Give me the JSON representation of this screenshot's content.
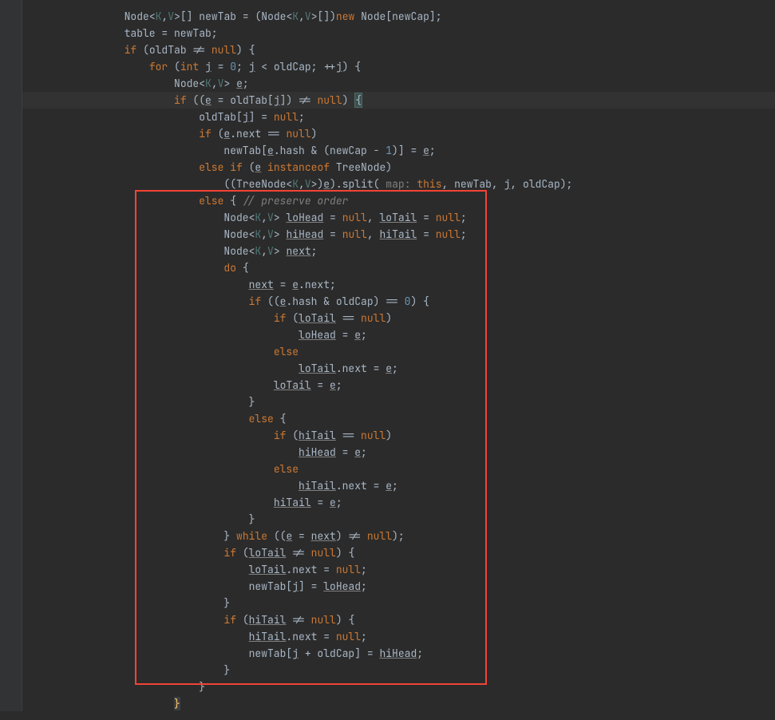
{
  "lines": [
    {
      "indent": 3,
      "tokens": [
        {
          "t": "Node",
          "c": "ty"
        },
        {
          "t": "<",
          "c": "op"
        },
        {
          "t": "K",
          "c": "gp"
        },
        {
          "t": ",",
          "c": "op"
        },
        {
          "t": "V",
          "c": "gp"
        },
        {
          "t": ">[] newTab = (Node",
          "c": "ty"
        },
        {
          "t": "<",
          "c": "op"
        },
        {
          "t": "K",
          "c": "gp"
        },
        {
          "t": ",",
          "c": "op"
        },
        {
          "t": "V",
          "c": "gp"
        },
        {
          "t": ">[])",
          "c": "ty"
        },
        {
          "t": "new ",
          "c": "kw"
        },
        {
          "t": "Node[newCap];",
          "c": "ty"
        }
      ]
    },
    {
      "indent": 3,
      "tokens": [
        {
          "t": "table = newTab;",
          "c": "ty"
        }
      ]
    },
    {
      "indent": 3,
      "tokens": [
        {
          "t": "if ",
          "c": "kw"
        },
        {
          "t": "(oldTab != ",
          "c": "ty"
        },
        {
          "t": "null",
          "c": "kw"
        },
        {
          "t": ") {",
          "c": "ty"
        }
      ]
    },
    {
      "indent": 4,
      "tokens": [
        {
          "t": "for ",
          "c": "kw"
        },
        {
          "t": "(",
          "c": "ty"
        },
        {
          "t": "int ",
          "c": "kw"
        },
        {
          "t": "j",
          "c": "ul"
        },
        {
          "t": " = ",
          "c": "ty"
        },
        {
          "t": "0",
          "c": "num"
        },
        {
          "t": "; ",
          "c": "ty"
        },
        {
          "t": "j",
          "c": "ul"
        },
        {
          "t": " < oldCap; ++",
          "c": "ty"
        },
        {
          "t": "j",
          "c": "ul"
        },
        {
          "t": ") {",
          "c": "ty"
        }
      ]
    },
    {
      "indent": 5,
      "tokens": [
        {
          "t": "Node",
          "c": "ty"
        },
        {
          "t": "<",
          "c": "op"
        },
        {
          "t": "K",
          "c": "gp"
        },
        {
          "t": ",",
          "c": "op"
        },
        {
          "t": "V",
          "c": "gp"
        },
        {
          "t": "> ",
          "c": "ty"
        },
        {
          "t": "e",
          "c": "ul"
        },
        {
          "t": ";",
          "c": "ty"
        }
      ]
    },
    {
      "indent": 5,
      "hl": true,
      "tokens": [
        {
          "t": "if ",
          "c": "kw"
        },
        {
          "t": "((",
          "c": "ty"
        },
        {
          "t": "e",
          "c": "ul"
        },
        {
          "t": " = oldTab[",
          "c": "ty"
        },
        {
          "t": "j",
          "c": "ul"
        },
        {
          "t": "]) != ",
          "c": "ty"
        },
        {
          "t": "null",
          "c": "kw"
        },
        {
          "t": ") ",
          "c": "ty"
        },
        {
          "t": "{",
          "c": "brace-match"
        }
      ]
    },
    {
      "indent": 6,
      "tokens": [
        {
          "t": "oldTab[",
          "c": "ty"
        },
        {
          "t": "j",
          "c": "ul"
        },
        {
          "t": "] = ",
          "c": "ty"
        },
        {
          "t": "null",
          "c": "kw"
        },
        {
          "t": ";",
          "c": "ty"
        }
      ]
    },
    {
      "indent": 6,
      "tokens": [
        {
          "t": "if ",
          "c": "kw"
        },
        {
          "t": "(",
          "c": "ty"
        },
        {
          "t": "e",
          "c": "ul"
        },
        {
          "t": ".next == ",
          "c": "ty"
        },
        {
          "t": "null",
          "c": "kw"
        },
        {
          "t": ")",
          "c": "ty"
        }
      ]
    },
    {
      "indent": 7,
      "tokens": [
        {
          "t": "newTab[",
          "c": "ty"
        },
        {
          "t": "e",
          "c": "ul"
        },
        {
          "t": ".hash & (newCap - ",
          "c": "ty"
        },
        {
          "t": "1",
          "c": "num"
        },
        {
          "t": ")] = ",
          "c": "ty"
        },
        {
          "t": "e",
          "c": "ul"
        },
        {
          "t": ";",
          "c": "ty"
        }
      ]
    },
    {
      "indent": 6,
      "tokens": [
        {
          "t": "else if ",
          "c": "kw"
        },
        {
          "t": "(",
          "c": "ty"
        },
        {
          "t": "e",
          "c": "ul"
        },
        {
          "t": " ",
          "c": "ty"
        },
        {
          "t": "instanceof ",
          "c": "kw"
        },
        {
          "t": "TreeNode)",
          "c": "ty"
        }
      ]
    },
    {
      "indent": 7,
      "tokens": [
        {
          "t": "((TreeNode",
          "c": "ty"
        },
        {
          "t": "<",
          "c": "op"
        },
        {
          "t": "K",
          "c": "gp"
        },
        {
          "t": ",",
          "c": "op"
        },
        {
          "t": "V",
          "c": "gp"
        },
        {
          "t": ">)",
          "c": "ty"
        },
        {
          "t": "e",
          "c": "ul"
        },
        {
          "t": ").split(",
          "c": "ty"
        },
        {
          "t": " map: ",
          "c": "lbl"
        },
        {
          "t": "this",
          "c": "kw"
        },
        {
          "t": ", newTab, ",
          "c": "ty"
        },
        {
          "t": "j",
          "c": "ul"
        },
        {
          "t": ", oldCap);",
          "c": "ty"
        }
      ]
    },
    {
      "indent": 6,
      "tokens": [
        {
          "t": "else ",
          "c": "kw"
        },
        {
          "t": "{ ",
          "c": "ty"
        },
        {
          "t": "// preserve order",
          "c": "cmt"
        }
      ]
    },
    {
      "indent": 7,
      "tokens": [
        {
          "t": "Node",
          "c": "ty"
        },
        {
          "t": "<",
          "c": "op"
        },
        {
          "t": "K",
          "c": "gp"
        },
        {
          "t": ",",
          "c": "op"
        },
        {
          "t": "V",
          "c": "gp"
        },
        {
          "t": "> ",
          "c": "ty"
        },
        {
          "t": "loHead",
          "c": "ul"
        },
        {
          "t": " = ",
          "c": "ty"
        },
        {
          "t": "null",
          "c": "kw"
        },
        {
          "t": ", ",
          "c": "ty"
        },
        {
          "t": "loTail",
          "c": "ul"
        },
        {
          "t": " = ",
          "c": "ty"
        },
        {
          "t": "null",
          "c": "kw"
        },
        {
          "t": ";",
          "c": "ty"
        }
      ]
    },
    {
      "indent": 7,
      "tokens": [
        {
          "t": "Node",
          "c": "ty"
        },
        {
          "t": "<",
          "c": "op"
        },
        {
          "t": "K",
          "c": "gp"
        },
        {
          "t": ",",
          "c": "op"
        },
        {
          "t": "V",
          "c": "gp"
        },
        {
          "t": "> ",
          "c": "ty"
        },
        {
          "t": "hiHead",
          "c": "ul"
        },
        {
          "t": " = ",
          "c": "ty"
        },
        {
          "t": "null",
          "c": "kw"
        },
        {
          "t": ", ",
          "c": "ty"
        },
        {
          "t": "hiTail",
          "c": "ul"
        },
        {
          "t": " = ",
          "c": "ty"
        },
        {
          "t": "null",
          "c": "kw"
        },
        {
          "t": ";",
          "c": "ty"
        }
      ]
    },
    {
      "indent": 7,
      "tokens": [
        {
          "t": "Node",
          "c": "ty"
        },
        {
          "t": "<",
          "c": "op"
        },
        {
          "t": "K",
          "c": "gp"
        },
        {
          "t": ",",
          "c": "op"
        },
        {
          "t": "V",
          "c": "gp"
        },
        {
          "t": "> ",
          "c": "ty"
        },
        {
          "t": "next",
          "c": "ul"
        },
        {
          "t": ";",
          "c": "ty"
        }
      ]
    },
    {
      "indent": 7,
      "tokens": [
        {
          "t": "do ",
          "c": "kw"
        },
        {
          "t": "{",
          "c": "ty"
        }
      ]
    },
    {
      "indent": 8,
      "tokens": [
        {
          "t": "next",
          "c": "ul"
        },
        {
          "t": " = ",
          "c": "ty"
        },
        {
          "t": "e",
          "c": "ul"
        },
        {
          "t": ".next;",
          "c": "ty"
        }
      ]
    },
    {
      "indent": 8,
      "tokens": [
        {
          "t": "if ",
          "c": "kw"
        },
        {
          "t": "((",
          "c": "ty"
        },
        {
          "t": "e",
          "c": "ul"
        },
        {
          "t": ".hash & oldCap) == ",
          "c": "ty"
        },
        {
          "t": "0",
          "c": "num"
        },
        {
          "t": ") {",
          "c": "ty"
        }
      ]
    },
    {
      "indent": 9,
      "tokens": [
        {
          "t": "if ",
          "c": "kw"
        },
        {
          "t": "(",
          "c": "ty"
        },
        {
          "t": "loTail",
          "c": "ul"
        },
        {
          "t": " == ",
          "c": "ty"
        },
        {
          "t": "null",
          "c": "kw"
        },
        {
          "t": ")",
          "c": "ty"
        }
      ]
    },
    {
      "indent": 10,
      "tokens": [
        {
          "t": "loHead",
          "c": "ul"
        },
        {
          "t": " = ",
          "c": "ty"
        },
        {
          "t": "e",
          "c": "ul"
        },
        {
          "t": ";",
          "c": "ty"
        }
      ]
    },
    {
      "indent": 9,
      "tokens": [
        {
          "t": "else",
          "c": "kw"
        }
      ]
    },
    {
      "indent": 10,
      "tokens": [
        {
          "t": "loTail",
          "c": "ul"
        },
        {
          "t": ".next = ",
          "c": "ty"
        },
        {
          "t": "e",
          "c": "ul"
        },
        {
          "t": ";",
          "c": "ty"
        }
      ]
    },
    {
      "indent": 9,
      "tokens": [
        {
          "t": "loTail",
          "c": "ul"
        },
        {
          "t": " = ",
          "c": "ty"
        },
        {
          "t": "e",
          "c": "ul"
        },
        {
          "t": ";",
          "c": "ty"
        }
      ]
    },
    {
      "indent": 8,
      "tokens": [
        {
          "t": "}",
          "c": "ty"
        }
      ]
    },
    {
      "indent": 8,
      "tokens": [
        {
          "t": "else ",
          "c": "kw"
        },
        {
          "t": "{",
          "c": "ty"
        }
      ]
    },
    {
      "indent": 9,
      "tokens": [
        {
          "t": "if ",
          "c": "kw"
        },
        {
          "t": "(",
          "c": "ty"
        },
        {
          "t": "hiTail",
          "c": "ul"
        },
        {
          "t": " == ",
          "c": "ty"
        },
        {
          "t": "null",
          "c": "kw"
        },
        {
          "t": ")",
          "c": "ty"
        }
      ]
    },
    {
      "indent": 10,
      "tokens": [
        {
          "t": "hiHead",
          "c": "ul"
        },
        {
          "t": " = ",
          "c": "ty"
        },
        {
          "t": "e",
          "c": "ul"
        },
        {
          "t": ";",
          "c": "ty"
        }
      ]
    },
    {
      "indent": 9,
      "tokens": [
        {
          "t": "else",
          "c": "kw"
        }
      ]
    },
    {
      "indent": 10,
      "tokens": [
        {
          "t": "hiTail",
          "c": "ul"
        },
        {
          "t": ".next = ",
          "c": "ty"
        },
        {
          "t": "e",
          "c": "ul"
        },
        {
          "t": ";",
          "c": "ty"
        }
      ]
    },
    {
      "indent": 9,
      "tokens": [
        {
          "t": "hiTail",
          "c": "ul"
        },
        {
          "t": " = ",
          "c": "ty"
        },
        {
          "t": "e",
          "c": "ul"
        },
        {
          "t": ";",
          "c": "ty"
        }
      ]
    },
    {
      "indent": 8,
      "tokens": [
        {
          "t": "}",
          "c": "ty"
        }
      ]
    },
    {
      "indent": 7,
      "tokens": [
        {
          "t": "} ",
          "c": "ty"
        },
        {
          "t": "while ",
          "c": "kw"
        },
        {
          "t": "((",
          "c": "ty"
        },
        {
          "t": "e",
          "c": "ul"
        },
        {
          "t": " = ",
          "c": "ty"
        },
        {
          "t": "next",
          "c": "ul"
        },
        {
          "t": ") != ",
          "c": "ty"
        },
        {
          "t": "null",
          "c": "kw"
        },
        {
          "t": ");",
          "c": "ty"
        }
      ]
    },
    {
      "indent": 7,
      "tokens": [
        {
          "t": "if ",
          "c": "kw"
        },
        {
          "t": "(",
          "c": "ty"
        },
        {
          "t": "loTail",
          "c": "ul"
        },
        {
          "t": " != ",
          "c": "ty"
        },
        {
          "t": "null",
          "c": "kw"
        },
        {
          "t": ") {",
          "c": "ty"
        }
      ]
    },
    {
      "indent": 8,
      "tokens": [
        {
          "t": "loTail",
          "c": "ul"
        },
        {
          "t": ".next = ",
          "c": "ty"
        },
        {
          "t": "null",
          "c": "kw"
        },
        {
          "t": ";",
          "c": "ty"
        }
      ]
    },
    {
      "indent": 8,
      "tokens": [
        {
          "t": "newTab[",
          "c": "ty"
        },
        {
          "t": "j",
          "c": "ul"
        },
        {
          "t": "] = ",
          "c": "ty"
        },
        {
          "t": "loHead",
          "c": "ul"
        },
        {
          "t": ";",
          "c": "ty"
        }
      ]
    },
    {
      "indent": 7,
      "tokens": [
        {
          "t": "}",
          "c": "ty"
        }
      ]
    },
    {
      "indent": 7,
      "tokens": [
        {
          "t": "if ",
          "c": "kw"
        },
        {
          "t": "(",
          "c": "ty"
        },
        {
          "t": "hiTail",
          "c": "ul"
        },
        {
          "t": " != ",
          "c": "ty"
        },
        {
          "t": "null",
          "c": "kw"
        },
        {
          "t": ") {",
          "c": "ty"
        }
      ]
    },
    {
      "indent": 8,
      "tokens": [
        {
          "t": "hiTail",
          "c": "ul"
        },
        {
          "t": ".next = ",
          "c": "ty"
        },
        {
          "t": "null",
          "c": "kw"
        },
        {
          "t": ";",
          "c": "ty"
        }
      ]
    },
    {
      "indent": 8,
      "tokens": [
        {
          "t": "newTab[",
          "c": "ty"
        },
        {
          "t": "j",
          "c": "ul"
        },
        {
          "t": " + oldCap] = ",
          "c": "ty"
        },
        {
          "t": "hiHead",
          "c": "ul"
        },
        {
          "t": ";",
          "c": "ty"
        }
      ]
    },
    {
      "indent": 7,
      "tokens": [
        {
          "t": "}",
          "c": "ty"
        }
      ]
    },
    {
      "indent": 6,
      "tokens": [
        {
          "t": "}",
          "c": "ty"
        }
      ]
    },
    {
      "indent": 5,
      "tokens": [
        {
          "t": "}",
          "c": "closing-brace-y"
        }
      ]
    }
  ],
  "indentUnit": "    ",
  "baseIndentPx": 34
}
